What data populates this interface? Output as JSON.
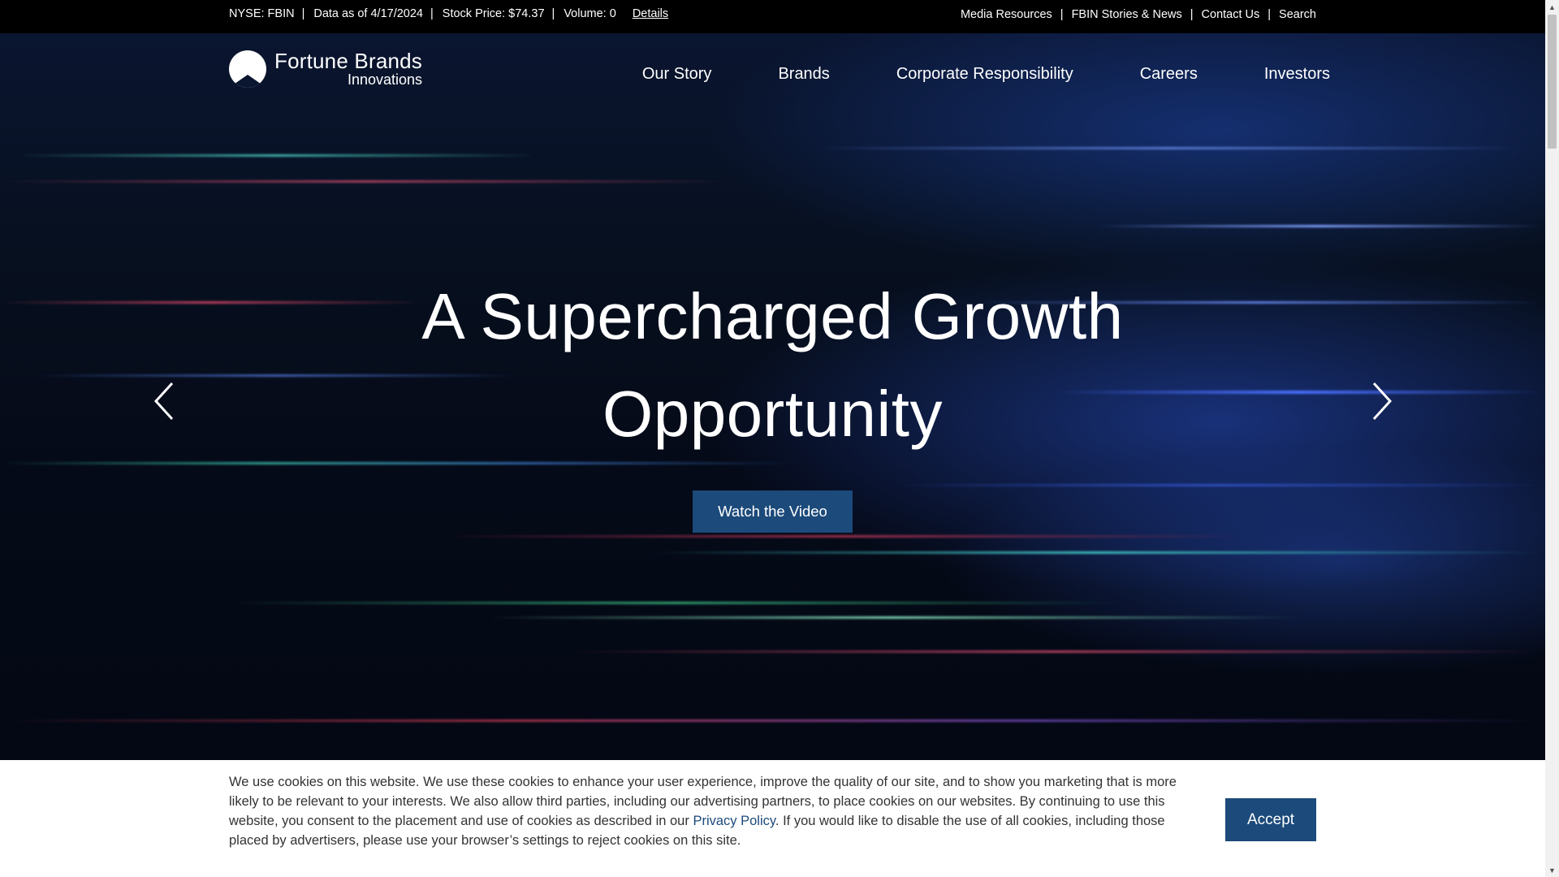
{
  "topbar": {
    "ticker": {
      "exchange": "NYSE: FBIN",
      "date": "Data as of 4/17/2024",
      "price": "Stock Price: $74.37",
      "volume": "Volume: 0",
      "details": "Details"
    },
    "utility": [
      "Media Resources",
      "FBIN Stories & News",
      "Contact Us",
      "Search"
    ],
    "separator": "|"
  },
  "logo": {
    "title": "Fortune Brands",
    "subtitle": "Innovations"
  },
  "nav": [
    "Our Story",
    "Brands",
    "Corporate Responsibility",
    "Careers",
    "Investors"
  ],
  "hero": {
    "headline_line1": "A Supercharged Growth",
    "headline_line2": "Opportunity",
    "cta": "Watch the Video"
  },
  "cookie": {
    "text_before": "We use cookies on this website. We use these cookies to enhance your user experience, improve the quality of our site, and to show you marketing that is more likely to be relevant to your interests. We also allow third parties, including our advertising partners, to place cookies on our websites. By continuing to use this website, you consent to the placement and use of cookies as described in our ",
    "link": "Privacy Policy",
    "text_after": ". If you would like to disable the use of all cookies, including those placed by advertisers, please use your browser’s settings to reject cookies on this site.",
    "accept": "Accept"
  },
  "colors": {
    "accent": "#1c4a7a",
    "banner_bg": "#ffffff",
    "topbar_bg": "#000000"
  },
  "icons": {
    "prev": "chevron-left-icon",
    "next": "chevron-right-icon",
    "logo": "fortune-brands-logo"
  }
}
